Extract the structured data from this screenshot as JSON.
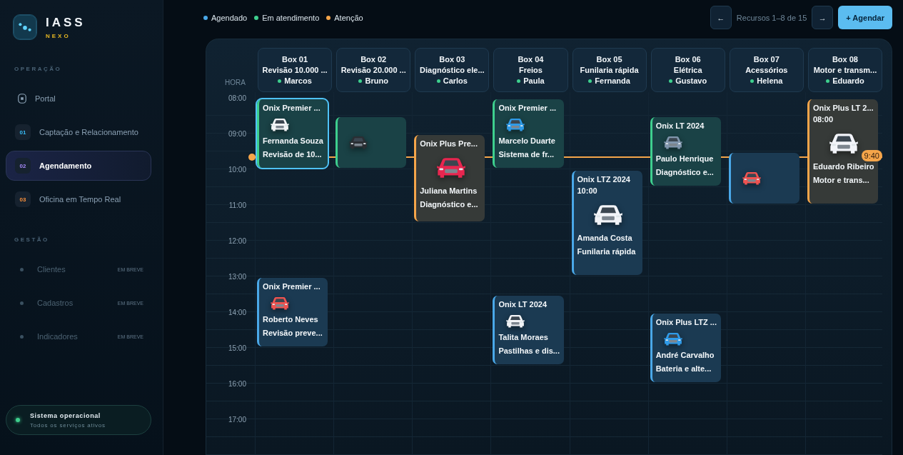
{
  "brand": {
    "name": "IASS",
    "sub": "NEXO"
  },
  "sidebar": {
    "sections": [
      {
        "title": "OPERAÇÃO",
        "items": [
          {
            "kind": "icon",
            "label": "Portal",
            "selected": false
          },
          {
            "kind": "number",
            "badge": "01",
            "color": "#38bdf8",
            "label": "Captação e Relacionamento",
            "selected": false
          },
          {
            "kind": "number",
            "badge": "02",
            "color": "#a78bfa",
            "label": "Agendamento",
            "selected": true
          },
          {
            "kind": "number",
            "badge": "03",
            "color": "#fb923c",
            "label": "Oficina em Tempo Real",
            "selected": false
          }
        ]
      },
      {
        "title": "GESTÃO",
        "items": [
          {
            "kind": "dot",
            "label": "Clientes",
            "tag": "EM BREVE",
            "disabled": true
          },
          {
            "kind": "dot",
            "label": "Cadastros",
            "tag": "EM BREVE",
            "disabled": true
          },
          {
            "kind": "dot",
            "label": "Indicadores",
            "tag": "EM BREVE",
            "disabled": true
          }
        ]
      }
    ],
    "status": {
      "title": "Sistema operacional",
      "subtitle": "Todos os serviços ativos"
    }
  },
  "legend": [
    {
      "label": "Agendado",
      "color": "#4aa8e8"
    },
    {
      "label": "Em atendimento",
      "color": "#3ecf8e"
    },
    {
      "label": "Atenção",
      "color": "#f5a54a"
    }
  ],
  "pager": {
    "prev": "←",
    "text": "Recursos 1–8 de 15",
    "next": "→",
    "action": "+ Agendar"
  },
  "schedule": {
    "hour_header": "HORA",
    "hours": [
      "08:00",
      "09:00",
      "10:00",
      "11:00",
      "12:00",
      "13:00",
      "14:00",
      "15:00",
      "16:00",
      "17:00"
    ],
    "now": "9:40",
    "resources": [
      {
        "name": "Box 01",
        "service": "Revisão 10.000 ...",
        "mechanic": "Marcos",
        "appointments": [
          {
            "kind": "servicing",
            "selected": true,
            "vehicle": "Onix Premier ...",
            "color": "#f2f4f6",
            "client": "Fernanda Souza",
            "service": "Revisão de 10..."
          },
          {
            "kind": "scheduled",
            "selected": false,
            "vehicle": "Onix Premier ...",
            "color": "#ef5350",
            "client": "Roberto Neves",
            "service": "Revisão preve..."
          }
        ]
      },
      {
        "name": "Box 02",
        "service": "Revisão 20.000 ...",
        "mechanic": "Bruno",
        "appointments": [
          {
            "kind": "servicing",
            "selected": false,
            "color": "#2a2e33"
          }
        ]
      },
      {
        "name": "Box 03",
        "service": "Diagnóstico ele...",
        "mechanic": "Carlos",
        "appointments": [
          {
            "kind": "attention",
            "selected": false,
            "vehicle": "Onix Plus Pre...",
            "color": "#e8264f",
            "client": "Juliana Martins",
            "service": "Diagnóstico e..."
          }
        ]
      },
      {
        "name": "Box 04",
        "service": "Freios",
        "mechanic": "Paula",
        "appointments": [
          {
            "kind": "servicing",
            "selected": false,
            "vehicle": "Onix Premier ...",
            "color": "#2f9be8",
            "client": "Marcelo Duarte",
            "service": "Sistema de fr..."
          },
          {
            "kind": "scheduled",
            "selected": false,
            "vehicle": "Onix LT 2024",
            "color": "#f2f4f7",
            "client": "Talita Moraes",
            "service": "Pastilhas e dis..."
          }
        ]
      },
      {
        "name": "Box 05",
        "service": "Funilaria rápida",
        "mechanic": "Fernanda",
        "appointments": [
          {
            "kind": "scheduled",
            "selected": false,
            "vehicle": "Onix LTZ 2024",
            "time": "10:00",
            "color": "#f2f4f8",
            "client": "Amanda Costa",
            "service": "Funilaria rápida"
          }
        ]
      },
      {
        "name": "Box 06",
        "service": "Elétrica",
        "mechanic": "Gustavo",
        "appointments": [
          {
            "kind": "servicing",
            "selected": false,
            "vehicle": "Onix LT 2024",
            "color": "#8096ad",
            "client": "Paulo Henrique",
            "service": "Diagnóstico e..."
          },
          {
            "kind": "scheduled",
            "selected": false,
            "vehicle": "Onix Plus LTZ ...",
            "color": "#2f9be9",
            "client": "André Carvalho",
            "service": "Bateria e alte..."
          }
        ]
      },
      {
        "name": "Box 07",
        "service": "Acessórios",
        "mechanic": "Helena",
        "appointments": [
          {
            "kind": "scheduled",
            "selected": false,
            "color": "#ef5351"
          }
        ]
      },
      {
        "name": "Box 08",
        "service": "Motor e transm...",
        "mechanic": "Eduardo",
        "appointments": [
          {
            "kind": "attention",
            "selected": false,
            "vehicle": "Onix Plus LT 2...",
            "time": "08:00",
            "color": "#f2f4f9",
            "client": "Eduardo Ribeiro",
            "service": "Motor e trans..."
          }
        ]
      }
    ]
  }
}
